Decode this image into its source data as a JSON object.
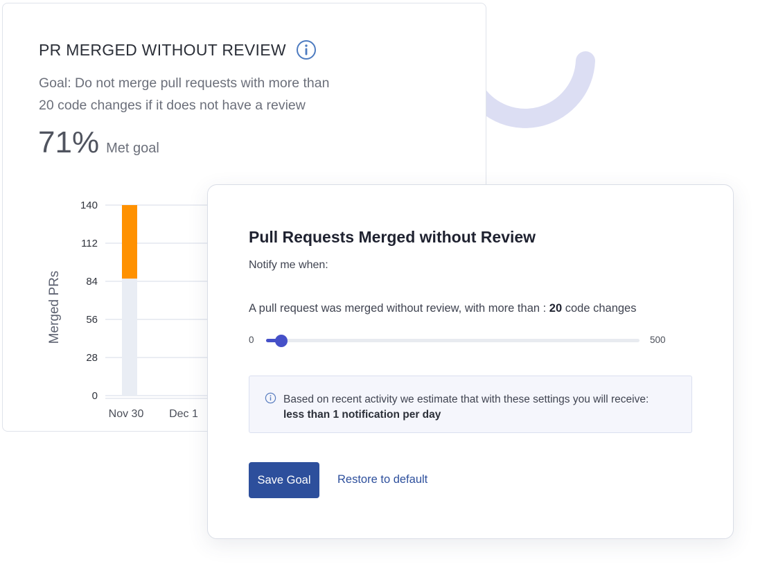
{
  "card": {
    "title": "PR MERGED WITHOUT REVIEW",
    "goal_line1": "Goal: Do not merge pull requests with more than",
    "goal_line2": "20 code changes if it does not have a review",
    "metric_value": "71%",
    "metric_label": "Met goal"
  },
  "chart_data": {
    "type": "bar",
    "ylabel": "Merged PRs",
    "xlabel": "",
    "ylim": [
      0,
      140
    ],
    "yticks": [
      0,
      28,
      56,
      84,
      112,
      140
    ],
    "categories": [
      "Nov 30",
      "Dec 1"
    ],
    "series": [
      {
        "values": [
          86,
          null
        ],
        "color": "#e9edf4"
      },
      {
        "values": [
          54,
          null
        ],
        "color": "#ff9100"
      }
    ]
  },
  "modal": {
    "title": "Pull Requests Merged without Review",
    "notify_label": "Notify me when:",
    "sentence_prefix": "A pull request was merged without review, with more than : ",
    "threshold": "20",
    "sentence_suffix": " code changes",
    "slider": {
      "min": "0",
      "max": "500",
      "value": 20
    },
    "estimate_text": "Based on recent activity we estimate that with these settings you will receive:",
    "estimate_strong": "less than 1 notification per day",
    "save_label": "Save Goal",
    "restore_label": "Restore to default"
  },
  "colors": {
    "accent": "#2d4f9c",
    "slider": "#4550c8",
    "bar_top": "#ff9100",
    "bar_base": "#e9edf4",
    "arc": "#dcdef3"
  },
  "icons": {
    "card_info": "info-icon",
    "estimate_info": "info-icon"
  }
}
